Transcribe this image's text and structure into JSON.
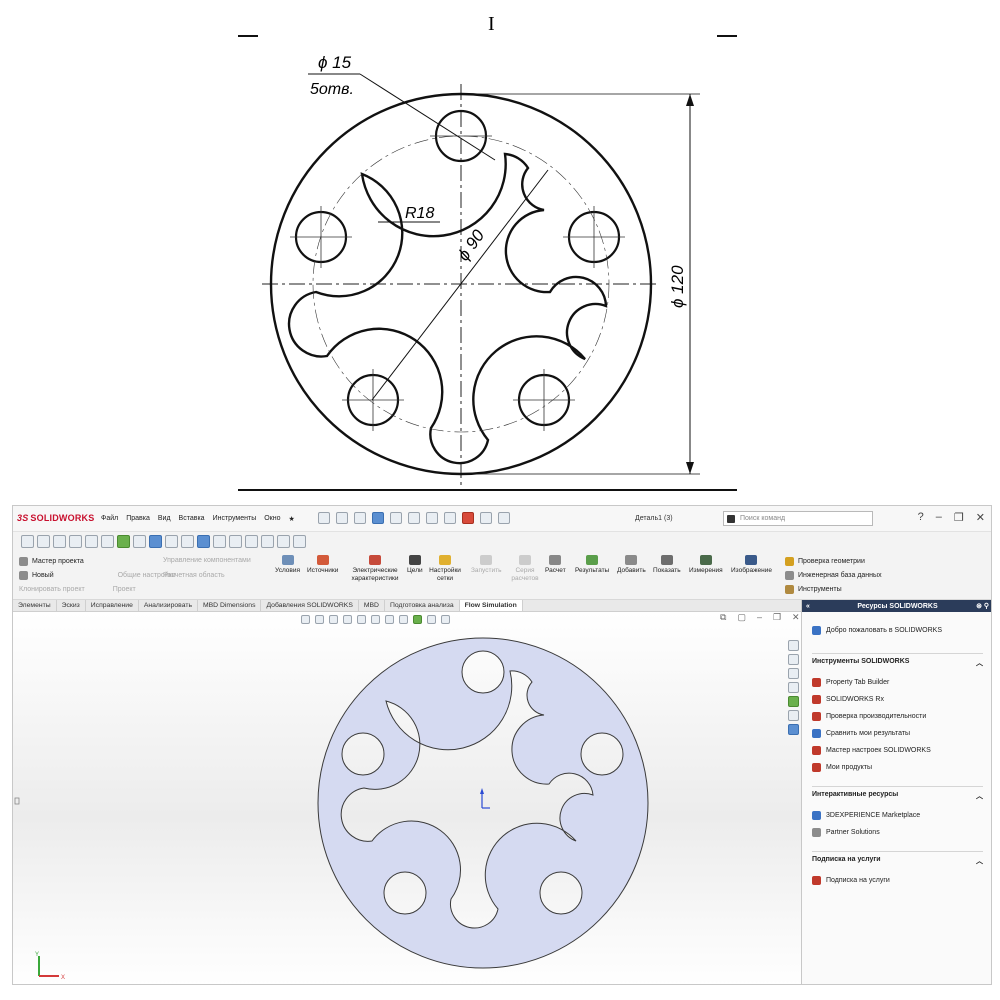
{
  "drawing": {
    "view_label": "I",
    "dim_hole_diameter": "ϕ 15",
    "dim_hole_count": "5отв.",
    "dim_radius": "R18",
    "dim_pcd": "ϕ 90",
    "dim_outer": "ϕ 120"
  },
  "app": {
    "logo_ds": "3S",
    "logo_text": "SOLIDWORKS",
    "menu": [
      "Файл",
      "Правка",
      "Вид",
      "Вставка",
      "Инструменты",
      "Окно"
    ],
    "document_title": "Деталь1 (3)",
    "search_placeholder": "Поиск команд"
  },
  "ribbon": {
    "left": {
      "project_wizard": "Мастер проекта",
      "new": "Новый",
      "clone": "Клонировать проект",
      "common_settings": "Общие настройки",
      "component_control": "Управление компонентами",
      "calc_area": "Расчетная область",
      "project": "Проект"
    },
    "buttons": [
      {
        "label": "Условия"
      },
      {
        "label": "Источники"
      },
      {
        "label": "Электрические характеристики"
      },
      {
        "label": "Цели"
      },
      {
        "label": "Настройки сетки"
      },
      {
        "label": "Запустить"
      },
      {
        "label": "Серия расчетов"
      },
      {
        "label": "Расчет"
      },
      {
        "label": "Результаты"
      },
      {
        "label": "Добавить"
      },
      {
        "label": "Показать"
      },
      {
        "label": "Измерения"
      },
      {
        "label": "Изображение"
      }
    ],
    "right": {
      "check_geometry": "Проверка геометрии",
      "engineering_db": "Инженерная база данных",
      "tools": "Инструменты"
    }
  },
  "tabs": [
    {
      "label": "Элементы"
    },
    {
      "label": "Эскиз"
    },
    {
      "label": "Исправление"
    },
    {
      "label": "Анализировать"
    },
    {
      "label": "MBD Dimensions"
    },
    {
      "label": "Добавления SOLIDWORKS"
    },
    {
      "label": "MBD"
    },
    {
      "label": "Подготовка анализа"
    },
    {
      "label": "Flow Simulation",
      "active": true
    }
  ],
  "taskpane": {
    "title": "Ресурсы SOLIDWORKS",
    "welcome": "Добро пожаловать в SOLIDWORKS",
    "sections": [
      {
        "title": "Инструменты SOLIDWORKS",
        "items": [
          "Property Tab Builder",
          "SOLIDWORKS Rx",
          "Проверка производительности",
          "Сравнить мои результаты",
          "Мастер настроек SOLIDWORKS",
          "Мои продукты"
        ]
      },
      {
        "title": "Интерактивные ресурсы",
        "items": [
          "3DEXPERIENCE Marketplace",
          "Partner Solutions"
        ]
      },
      {
        "title": "Подписка на услуги",
        "items": [
          "Подписка на услуги"
        ]
      }
    ]
  },
  "colors": {
    "part_fill": "#d5daf1",
    "part_edge": "#3a3a3a",
    "logo": "#c8102e",
    "taskpane_header": "#2b3c5a"
  }
}
